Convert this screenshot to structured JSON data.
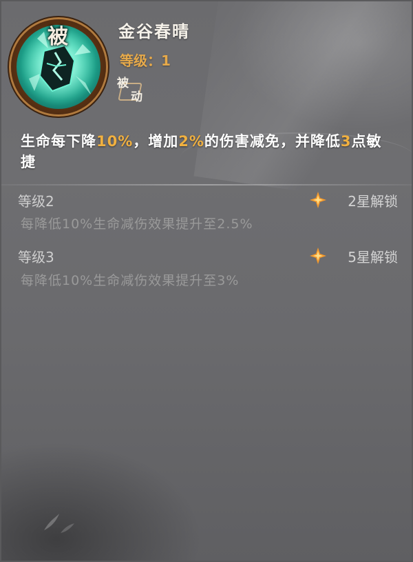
{
  "skill": {
    "icon_badge": "被",
    "name": "金谷春晴",
    "level_text": "等级：1",
    "type_char_1": "被",
    "type_char_2": "动",
    "description": {
      "p1": "生命每下降",
      "v1": "10%",
      "p2": "，增加",
      "v2": "2%",
      "p3": "的伤害减免，并降低",
      "v3": "3",
      "p4": "点敏捷"
    }
  },
  "upgrades": [
    {
      "level_label": "等级2",
      "unlock_text": "2星解锁",
      "effect": "每降低10%生命减伤效果提升至2.5%"
    },
    {
      "level_label": "等级3",
      "unlock_text": "5星解锁",
      "effect": "每降低10%生命减伤效果提升至3%"
    }
  ],
  "colors": {
    "highlight": "#f0b040",
    "level_text": "#e6a94a",
    "star": "#f59a2c"
  },
  "icons": {
    "skill_icon": "green-crystal-shield-icon",
    "unlock_icon": "four-point-star-icon"
  }
}
